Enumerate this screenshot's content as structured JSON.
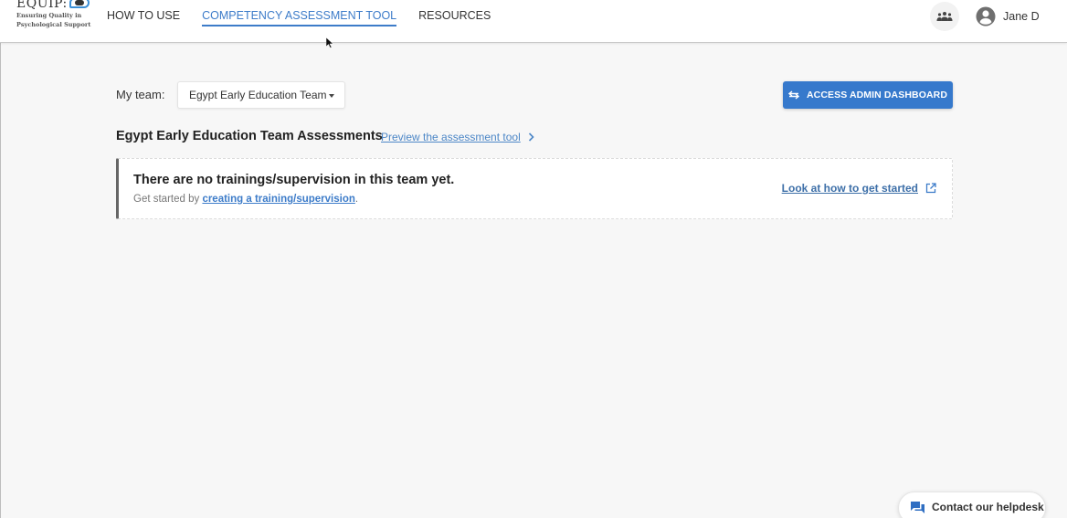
{
  "header": {
    "logo": {
      "title": "EQUIP:",
      "subtitle_line1": "Ensuring Quality in",
      "subtitle_line2": "Psychological Support"
    },
    "nav": [
      {
        "label": "HOW TO USE",
        "active": false
      },
      {
        "label": "COMPETENCY ASSESSMENT TOOL",
        "active": true
      },
      {
        "label": "RESOURCES",
        "active": false
      }
    ],
    "team_icon": "team-icon",
    "user": {
      "icon": "account-circle-icon",
      "name": "Jane D"
    }
  },
  "main": {
    "my_team_label": "My team:",
    "team_select": {
      "selected": "Egypt Early Education Team",
      "icon": "caret-down-icon"
    },
    "admin_button": {
      "label": "ACCESS ADMIN DASHBOARD",
      "icon": "swap-arrows-icon"
    },
    "section_title": "Egypt Early Education Team Assessments",
    "preview_link": {
      "label": "Preview the assessment tool",
      "icon": "chevron-right-icon"
    },
    "empty_state": {
      "title": "There are no trainings/supervision in this team yet.",
      "subtitle_prefix": "Get started by ",
      "subtitle_link": "creating a training/supervision",
      "subtitle_suffix": ".",
      "help_link": {
        "label": "Look at how to get started",
        "icon": "external-link-icon"
      }
    }
  },
  "helpdesk": {
    "label": "Contact our helpdesk",
    "icon": "chat-icon"
  },
  "colors": {
    "accent": "#3679cc",
    "link": "#3d7cc9",
    "background": "#f7f7f7"
  }
}
